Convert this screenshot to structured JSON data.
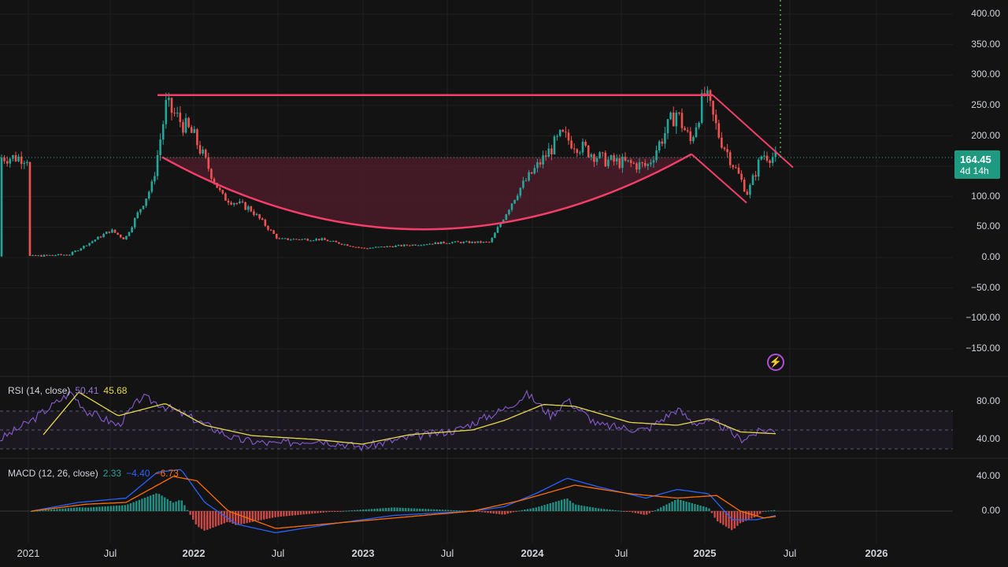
{
  "colors": {
    "background": "#131313",
    "up": "#26a69a",
    "down": "#ef5350",
    "pattern": "#f23f6a",
    "cup_fill": "#4a1c2a",
    "rsi_line": "#7e57c2",
    "rsi_ma": "#e6d84d",
    "macd_line": "#2962ff",
    "signal_line": "#ff6d00",
    "hist_up": "#26a69a",
    "hist_down": "#ef5350",
    "grid": "#1f1f1f"
  },
  "price_axis": {
    "ticks": [
      "400.00",
      "350.00",
      "300.00",
      "250.00",
      "200.00",
      "150.00",
      "100.00",
      "50.00",
      "0.00",
      "−50.00",
      "−100.00",
      "−150.00"
    ]
  },
  "time_axis": {
    "ticks": [
      {
        "label": "2021",
        "bold": false
      },
      {
        "label": "Jul",
        "bold": false
      },
      {
        "label": "2022",
        "bold": true
      },
      {
        "label": "Jul",
        "bold": false
      },
      {
        "label": "2023",
        "bold": true
      },
      {
        "label": "Jul",
        "bold": false
      },
      {
        "label": "2024",
        "bold": true
      },
      {
        "label": "Jul",
        "bold": false
      },
      {
        "label": "2025",
        "bold": true
      },
      {
        "label": "Jul",
        "bold": false
      },
      {
        "label": "2026",
        "bold": true
      }
    ]
  },
  "price_tag": {
    "price": "164.45",
    "countdown": "4d 14h"
  },
  "rsi": {
    "title": "RSI (14, close)",
    "value": "50.41",
    "ma_value": "45.68",
    "ticks": [
      "80.00",
      "40.00"
    ]
  },
  "macd": {
    "title": "MACD (12, 26, close)",
    "hist_value": "2.33",
    "macd_value": "−4.40",
    "signal_value": "−6.73",
    "ticks": [
      "40.00",
      "0.00"
    ]
  },
  "icons": {
    "alert": "lightning-icon"
  },
  "chart_data": {
    "type": "line",
    "description_series": "weekly candlestick price with cup-and-handle pattern overlay",
    "x": [
      "2021-01",
      "2021-04",
      "2021-07",
      "2021-08",
      "2021-10",
      "2021-11",
      "2022-01",
      "2022-03",
      "2022-05",
      "2022-07",
      "2022-10",
      "2023-01",
      "2023-04",
      "2023-07",
      "2023-10",
      "2023-12",
      "2024-03",
      "2024-06",
      "2024-09",
      "2024-11",
      "2024-12",
      "2025-01",
      "2025-02",
      "2025-04",
      "2025-05",
      "2025-06"
    ],
    "series": [
      {
        "name": "",
        "values": [
          2,
          5,
          45,
          30,
          120,
          250,
          200,
          100,
          80,
          30,
          30,
          15,
          20,
          25,
          25,
          110,
          200,
          160,
          150,
          240,
          190,
          270,
          200,
          105,
          170,
          164.45
        ]
      }
    ],
    "ylim": [
      -175,
      420
    ],
    "resistance_level": 267,
    "current_price": 164.45
  }
}
